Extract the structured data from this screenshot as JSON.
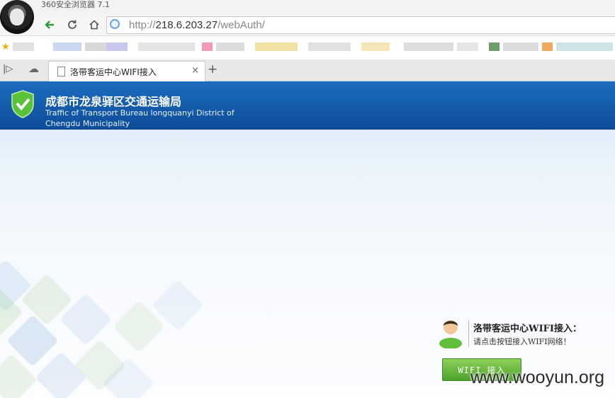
{
  "browser": {
    "app_title": "360安全浏览器 7.1",
    "url_scheme": "http://",
    "url_host": "218.6.203.27",
    "url_path": "/webAuth/",
    "tab_title": "洛带客运中心WIFI接入",
    "tab_close": "×",
    "new_tab": "+"
  },
  "icons": {
    "back": "arrow-left-icon",
    "reload": "refresh-icon",
    "home": "home-icon",
    "site": "globe-icon",
    "sidebar": "sidebar-toggle-icon",
    "cloud": "cloud-icon"
  },
  "header": {
    "title": "成都市龙泉驿区交通运输局",
    "subtitle_line1": "Traffic of Transport Bureau longquanyi District of",
    "subtitle_line2": "Chengdu Municipality"
  },
  "panel": {
    "title": "洛带客运中心WIFI接入：",
    "description": "请点击按钮接入WIFI网络！",
    "button_label": "WIFI 接入"
  },
  "watermark": "www.wooyun.org",
  "colors": {
    "header_blue": "#1c6cc0",
    "button_green": "#4aa32a",
    "back_arrow_green": "#2a9d3a"
  }
}
